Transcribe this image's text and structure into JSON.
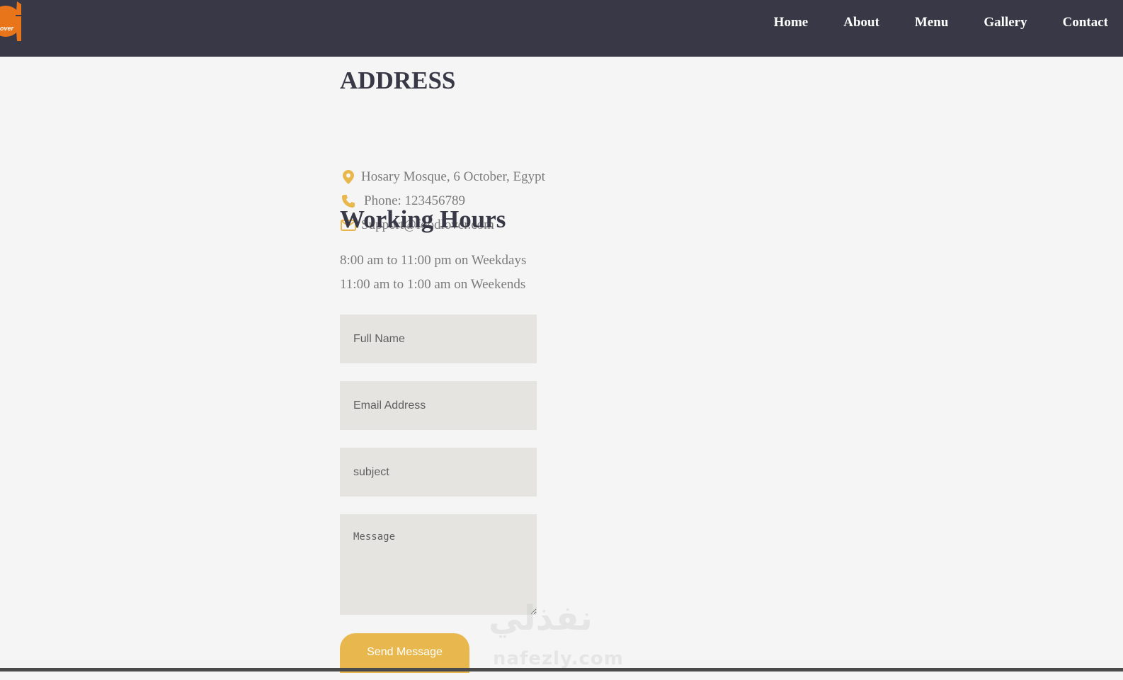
{
  "header": {
    "logo_text": "over",
    "nav": [
      "Home",
      "About",
      "Menu",
      "Gallery",
      "Contact"
    ]
  },
  "address": {
    "title": "ADDRESS",
    "location": "Hosary Mosque, 6 October, Egypt",
    "phone": "Phone: 123456789",
    "email": "Support@foodlover.com"
  },
  "hours": {
    "title": "Working Hours",
    "weekdays": "8:00 am to 11:00 pm on Weekdays",
    "weekends": "11:00 am to 1:00 am on Weekends"
  },
  "form": {
    "name_placeholder": "Full Name",
    "email_placeholder": "Email Address",
    "subject_placeholder": "subject",
    "message_placeholder": "Message",
    "submit_label": "Send Message"
  },
  "watermark": {
    "arabic": "نفذلي",
    "latin": "nafezly.com"
  },
  "colors": {
    "navbar": "#383846",
    "accent": "#e8b84e",
    "logo": "#e8751a",
    "field_bg": "#e5e4e0",
    "page_bg": "#f5f5f5"
  },
  "icons": [
    "map-pin-icon",
    "phone-icon",
    "mail-icon"
  ]
}
